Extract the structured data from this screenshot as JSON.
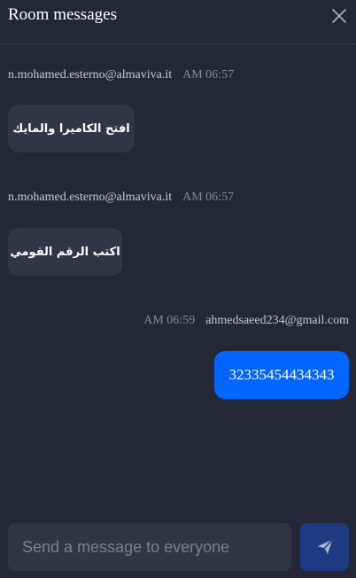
{
  "header": {
    "title": "Room messages",
    "close_icon": "close-icon"
  },
  "messages": [
    {
      "sender": "n.mohamed.esterno@almaviva.it",
      "time": "AM 06:57",
      "text": "افتح الكاميرا والمايك",
      "own": false
    },
    {
      "sender": "n.mohamed.esterno@almaviva.it",
      "time": "AM 06:57",
      "text": "اكتب الرقم القومي",
      "own": false
    },
    {
      "sender": "ahmedsaeed234@gmail.com",
      "time": "AM 06:59",
      "text": "32335454434343",
      "own": true
    }
  ],
  "composer": {
    "placeholder": "Send a message to everyone",
    "value": "",
    "send_icon": "send-icon"
  },
  "colors": {
    "background": "#242736",
    "bubble_other": "#323545",
    "bubble_own": "#0066ff",
    "send_button": "#1e3a82"
  }
}
